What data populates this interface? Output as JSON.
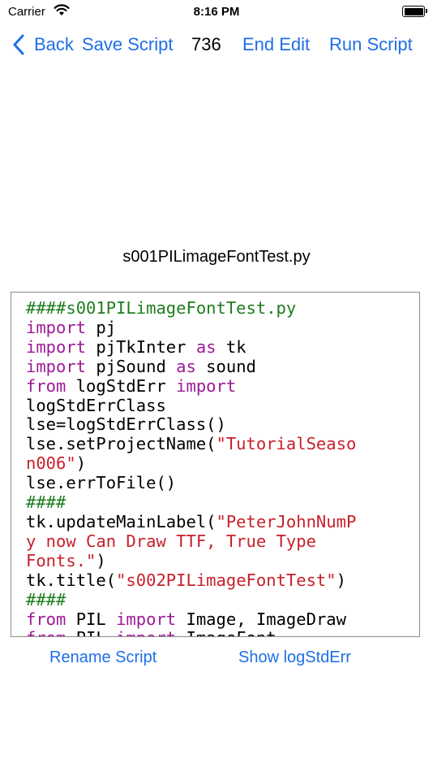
{
  "status": {
    "carrier": "Carrier",
    "time": "8:16 PM"
  },
  "toolbar": {
    "back_label": "Back",
    "save_label": "Save Script",
    "count": "736",
    "end_edit_label": "End Edit",
    "run_label": "Run Script"
  },
  "file_name": "s001PILimageFontTest.py",
  "code_lines": [
    [
      [
        "cm",
        "####s001PILimageFontTest.py"
      ]
    ],
    [
      [
        "kw",
        "import"
      ],
      [
        "p",
        " pj"
      ]
    ],
    [
      [
        "kw",
        "import"
      ],
      [
        "p",
        " pjTkInter "
      ],
      [
        "kw",
        "as"
      ],
      [
        "p",
        " tk"
      ]
    ],
    [
      [
        "kw",
        "import"
      ],
      [
        "p",
        " pjSound "
      ],
      [
        "kw",
        "as"
      ],
      [
        "p",
        " sound"
      ]
    ],
    [
      [
        "kw",
        "from"
      ],
      [
        "p",
        " logStdErr "
      ],
      [
        "kw",
        "import"
      ]
    ],
    [
      [
        "p",
        "logStdErrClass"
      ]
    ],
    [
      [
        "p",
        "lse=logStdErrClass()"
      ]
    ],
    [
      [
        "p",
        "lse.setProjectName("
      ],
      [
        "str",
        "\"TutorialSeaso"
      ]
    ],
    [
      [
        "str",
        "n006\""
      ],
      [
        "p",
        ")"
      ]
    ],
    [
      [
        "p",
        "lse.errToFile()"
      ]
    ],
    [
      [
        "cm",
        "####"
      ]
    ],
    [
      [
        "p",
        "tk.updateMainLabel("
      ],
      [
        "str",
        "\"PeterJohnNumP"
      ]
    ],
    [
      [
        "str",
        "y now Can Draw TTF, True Type"
      ]
    ],
    [
      [
        "str",
        "Fonts.\""
      ],
      [
        "p",
        ")"
      ]
    ],
    [
      [
        "p",
        "tk.title("
      ],
      [
        "str",
        "\"s002PILimageFontTest\""
      ],
      [
        "p",
        ")"
      ]
    ],
    [
      [
        "cm",
        "####"
      ]
    ],
    [
      [
        "kw",
        "from"
      ],
      [
        "p",
        " PIL "
      ],
      [
        "kw",
        "import"
      ],
      [
        "p",
        " Image, ImageDraw"
      ]
    ],
    [
      [
        "kw",
        "from"
      ],
      [
        "p",
        " PIL "
      ],
      [
        "kw",
        "import"
      ],
      [
        "p",
        " ImageFont"
      ]
    ]
  ],
  "bottom": {
    "rename_label": "Rename Script",
    "show_log_label": "Show logStdErr"
  },
  "colors": {
    "accent": "#1e6fe8",
    "keyword": "#9c1b95",
    "string": "#c8202a",
    "comment": "#1e7d1e"
  }
}
